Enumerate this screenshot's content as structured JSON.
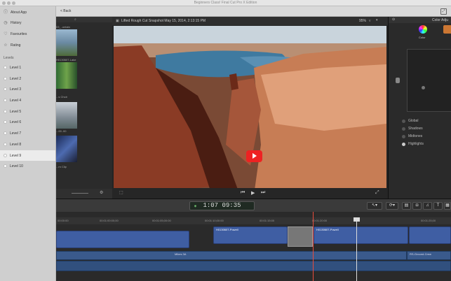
{
  "window": {
    "title": "Beginners Class! Final Cut Pro X Edition"
  },
  "sidebar": {
    "top_items": [
      {
        "label": "About App",
        "icon": "info-icon"
      },
      {
        "label": "History",
        "icon": "clock-icon"
      },
      {
        "label": "Favourites",
        "icon": "heart-icon"
      },
      {
        "label": "Rating",
        "icon": "star-icon"
      }
    ],
    "section_label": "Levels",
    "levels": [
      "Level 1",
      "Level 2",
      "Level 3",
      "Level 4",
      "Level 5",
      "Level 6",
      "Level 7",
      "Level 8",
      "Level 9",
      "Level 10"
    ],
    "selected_level": "Level 9"
  },
  "topbar": {
    "back_label": "< Back"
  },
  "browser": {
    "thumbs": [
      {
        "label": "03_..untain"
      },
      {
        "label": "H0130607-Lake"
      },
      {
        "label": "...s Choir"
      },
      {
        "label": "...00..00"
      },
      {
        "label": "...rn Clip"
      }
    ]
  },
  "viewer": {
    "title": "Lifted Rough Cut Snapshot May 15, 2014, 2:13:15 PM",
    "zoom": "95%",
    "zoom_suffix": "v"
  },
  "inspector": {
    "title": "Color Adju",
    "tab_label": "Color",
    "options": [
      "Global",
      "Shadows",
      "Midtones",
      "Highlights"
    ],
    "selected_option": "Highlights"
  },
  "toolbar": {
    "timecode": "1:07 09:35"
  },
  "timeline": {
    "ruler_ticks": [
      "00:00:00",
      "00:01:00:00;00",
      "00:01:05;00:00",
      "00:01:10;00:00",
      "00:01:15:00",
      "00:01:20:00",
      "00:01:25;00"
    ],
    "clips": [
      "H0130607-Powell",
      "H0130607-Powell"
    ],
    "audio_labels": [
      "Mikes 3A",
      "RS-Ground-Crew"
    ]
  },
  "colors": {
    "accent": "#e74c3c",
    "clip_blue": "#3f5ea3"
  }
}
